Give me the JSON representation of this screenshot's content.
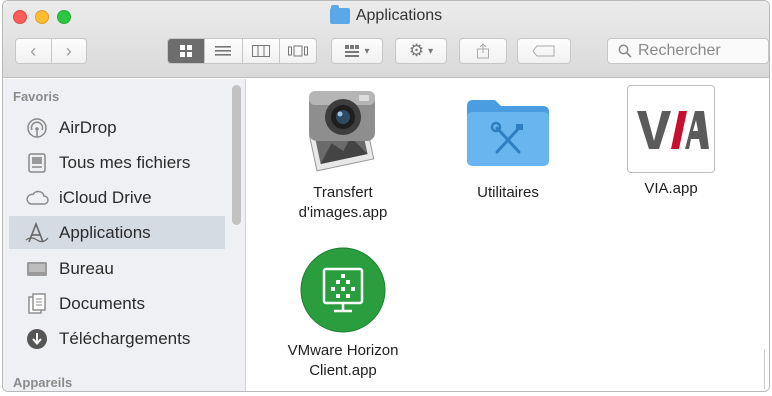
{
  "window": {
    "title": "Applications"
  },
  "toolbar": {
    "back": "‹",
    "forward": "›",
    "search_placeholder": "Rechercher"
  },
  "sidebar": {
    "favorites_title": "Favoris",
    "devices_title": "Appareils",
    "items": [
      {
        "label": "AirDrop",
        "icon": "airdrop-icon"
      },
      {
        "label": "Tous mes fichiers",
        "icon": "all-files-icon"
      },
      {
        "label": "iCloud Drive",
        "icon": "cloud-icon"
      },
      {
        "label": "Applications",
        "icon": "applications-icon",
        "selected": true
      },
      {
        "label": "Bureau",
        "icon": "desktop-icon"
      },
      {
        "label": "Documents",
        "icon": "documents-icon"
      },
      {
        "label": "Téléchargements",
        "icon": "downloads-icon"
      }
    ]
  },
  "content": {
    "apps": [
      {
        "label": "Transfert\nd'images.app",
        "icon": "image-capture-icon"
      },
      {
        "label": "Utilitaires",
        "icon": "utilities-folder-icon"
      },
      {
        "label": "VIA.app",
        "icon": "via-app-icon",
        "logo_text": "VIA"
      },
      {
        "label": "VMware Horizon\nClient.app",
        "icon": "vmware-horizon-icon"
      }
    ]
  },
  "colors": {
    "selection": "#d5dbe3",
    "folder_blue": "#5aa8e8",
    "vmware_green": "#2a9d3f",
    "via_red": "#c8102e"
  }
}
